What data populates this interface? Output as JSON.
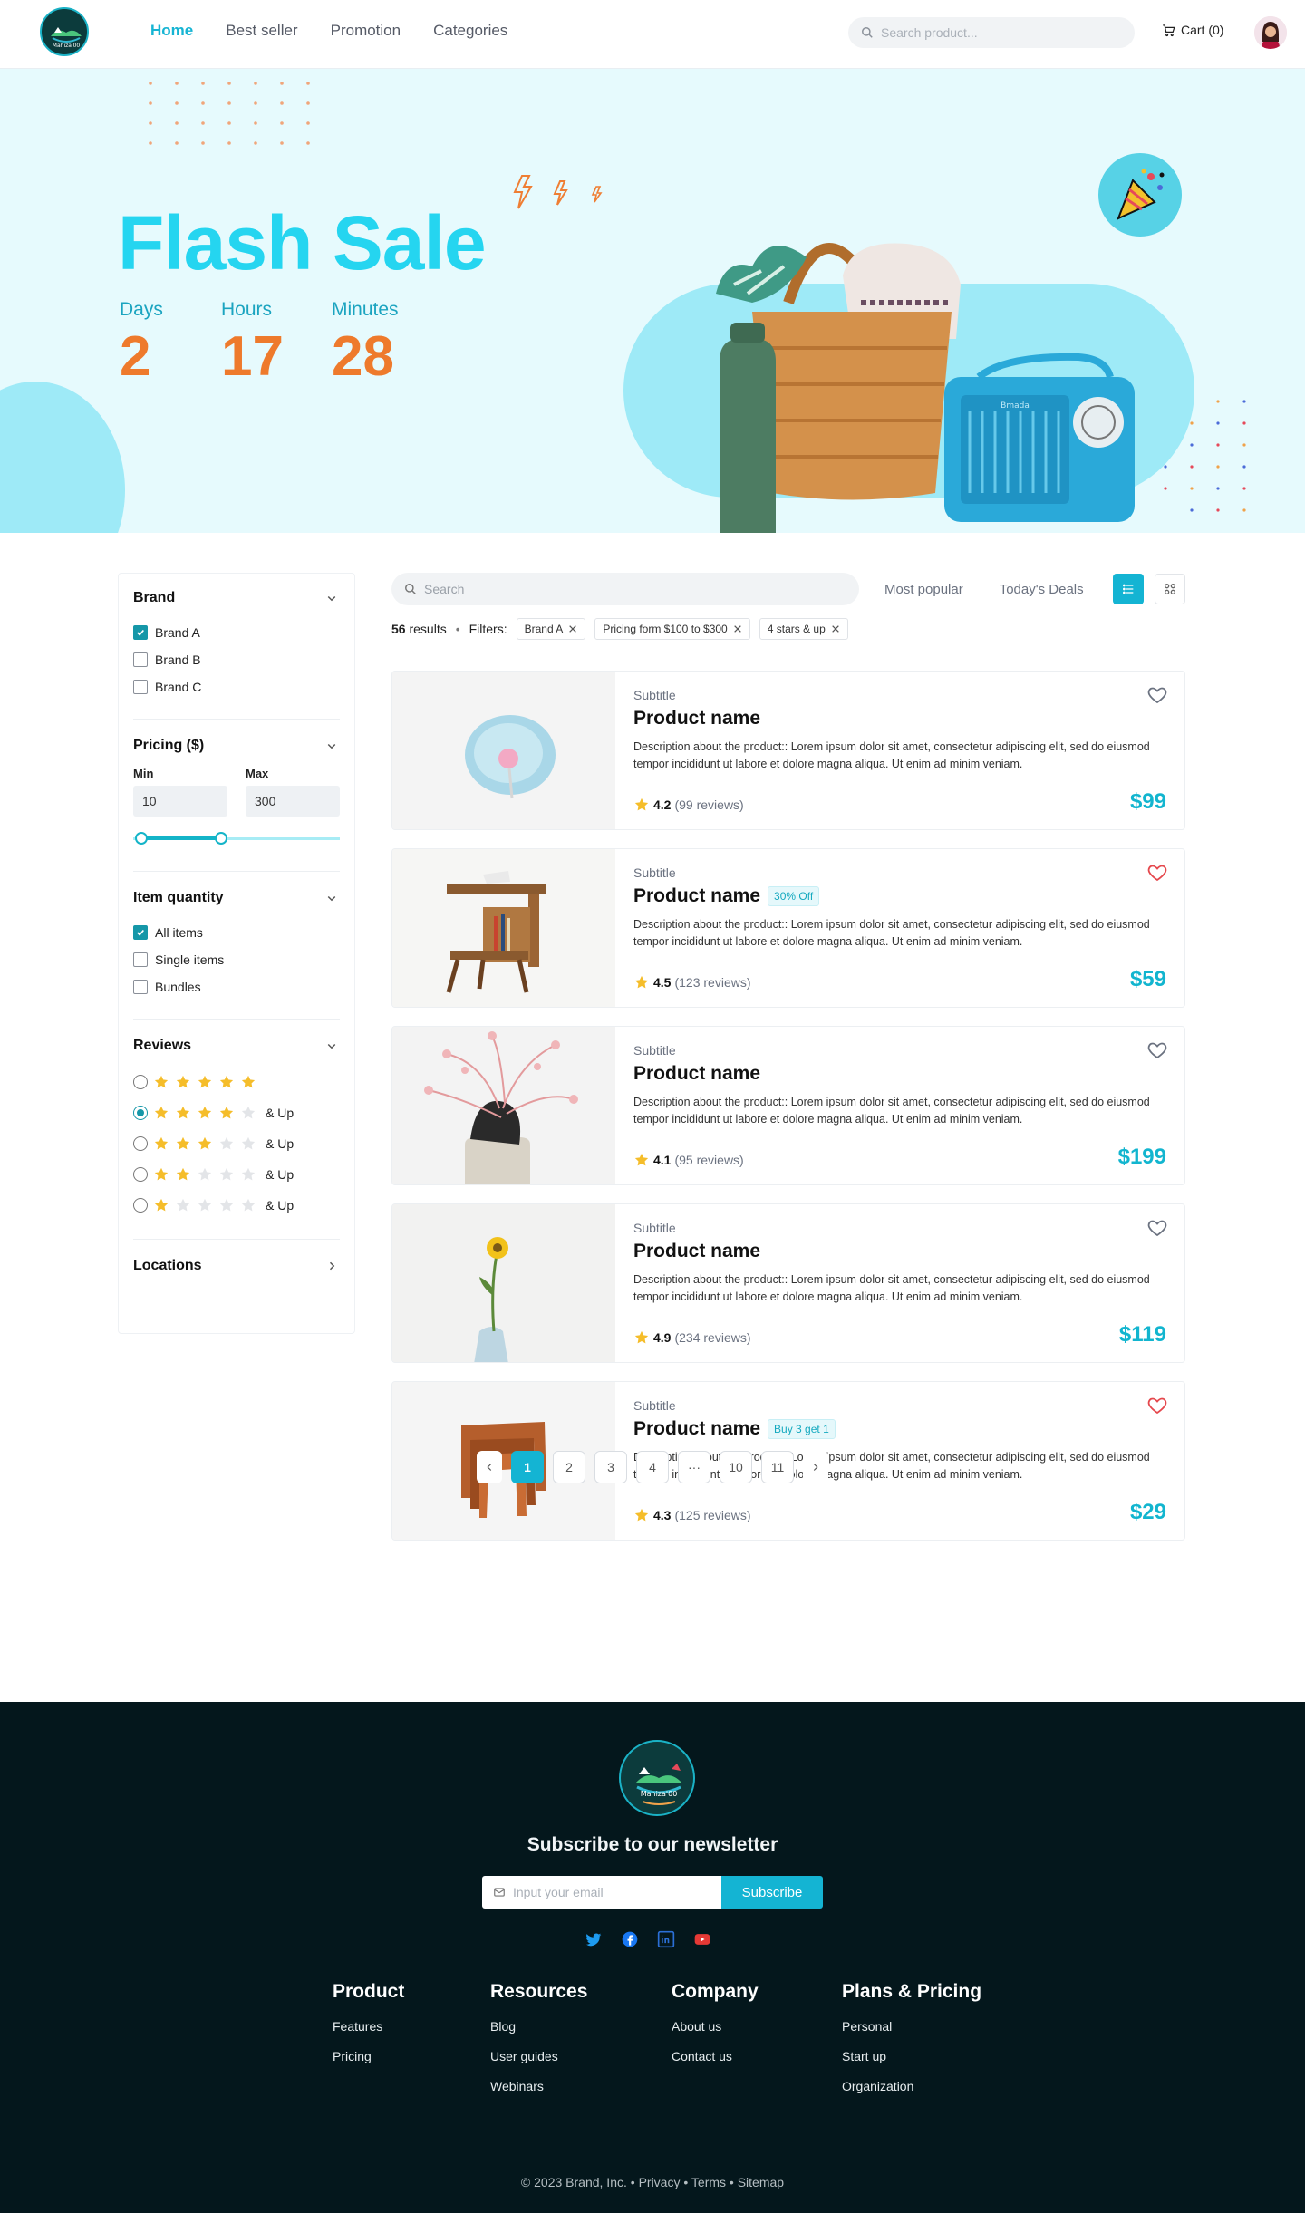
{
  "header": {
    "logo_text": "Mahiza'00",
    "nav": [
      "Home",
      "Best seller",
      "Promotion",
      "Categories"
    ],
    "search_placeholder": "Search product...",
    "cart_label": "Cart (0)"
  },
  "hero": {
    "title": "Flash Sale",
    "countdown": [
      {
        "label": "Days",
        "value": "2"
      },
      {
        "label": "Hours",
        "value": "17"
      },
      {
        "label": "Minutes",
        "value": "28"
      }
    ],
    "radio_brand_text": "Bmada"
  },
  "filters": {
    "brand": {
      "title": "Brand",
      "items": [
        {
          "label": "Brand A",
          "checked": true
        },
        {
          "label": "Brand B",
          "checked": false
        },
        {
          "label": "Brand C",
          "checked": false
        }
      ]
    },
    "pricing": {
      "title": "Pricing ($)",
      "min_label": "Min",
      "max_label": "Max",
      "min_value": "10",
      "max_value": "300"
    },
    "quantity": {
      "title": "Item quantity",
      "items": [
        {
          "label": "All items",
          "checked": true
        },
        {
          "label": "Single items",
          "checked": false
        },
        {
          "label": "Bundles",
          "checked": false
        }
      ]
    },
    "reviews": {
      "title": "Reviews",
      "and_up": "& Up",
      "selected": 4,
      "options": [
        5,
        4,
        3,
        2,
        1
      ]
    },
    "locations": {
      "title": "Locations"
    }
  },
  "toolbar": {
    "search_placeholder": "Search",
    "tabs": [
      "Most popular",
      "Today's Deals"
    ],
    "results_count": "56",
    "results_label": "results",
    "filters_label": "Filters:",
    "active_filters": [
      "Brand A",
      "Pricing form $100 to $300",
      "4 stars & up"
    ]
  },
  "products": [
    {
      "subtitle": "Subtitle",
      "name": "Product name",
      "badge": "",
      "desc": "Description about the product:: Lorem ipsum dolor sit amet, consectetur adipiscing elit, sed do eiusmod tempor incididunt ut labore et dolore magna aliqua. Ut enim ad minim veniam.",
      "rating": "4.2",
      "reviews": "(99 reviews)",
      "price": "$99",
      "liked": false
    },
    {
      "subtitle": "Subtitle",
      "name": "Product name",
      "badge": "30% Off",
      "desc": "Description about the product:: Lorem ipsum dolor sit amet, consectetur adipiscing elit, sed do eiusmod tempor incididunt ut labore et dolore magna aliqua. Ut enim ad minim veniam.",
      "rating": "4.5",
      "reviews": "(123 reviews)",
      "price": "$59",
      "liked": true
    },
    {
      "subtitle": "Subtitle",
      "name": "Product name",
      "badge": "",
      "desc": "Description about the product:: Lorem ipsum dolor sit amet, consectetur adipiscing elit, sed do eiusmod tempor incididunt ut labore et dolore magna aliqua. Ut enim ad minim veniam.",
      "rating": "4.1",
      "reviews": "(95 reviews)",
      "price": "$199",
      "liked": false
    },
    {
      "subtitle": "Subtitle",
      "name": "Product name",
      "badge": "",
      "desc": "Description about the product:: Lorem ipsum dolor sit amet, consectetur adipiscing elit, sed do eiusmod tempor incididunt ut labore et dolore magna aliqua. Ut enim ad minim veniam.",
      "rating": "4.9",
      "reviews": "(234 reviews)",
      "price": "$119",
      "liked": false
    },
    {
      "subtitle": "Subtitle",
      "name": "Product name",
      "badge": "Buy 3 get 1",
      "desc": "Description about the product:: Lorem ipsum dolor sit amet, consectetur adipiscing elit, sed do eiusmod tempor incididunt ut labore et dolore magna aliqua. Ut enim ad minim veniam.",
      "rating": "4.3",
      "reviews": "(125 reviews)",
      "price": "$29",
      "liked": true
    }
  ],
  "pagination": {
    "pages": [
      "1",
      "2",
      "3",
      "4",
      "···",
      "10",
      "11"
    ],
    "current": "1"
  },
  "footer": {
    "logo_text": "Mahiza'00",
    "newsletter_title": "Subscribe to our newsletter",
    "email_placeholder": "Input your email",
    "subscribe_label": "Subscribe",
    "social_icons": [
      "twitter-icon",
      "facebook-icon",
      "linkedin-icon",
      "youtube-icon"
    ],
    "columns": [
      {
        "title": "Product",
        "links": [
          "Features",
          "Pricing"
        ]
      },
      {
        "title": "Resources",
        "links": [
          "Blog",
          "User guides",
          "Webinars"
        ]
      },
      {
        "title": "Company",
        "links": [
          "About us",
          "Contact us"
        ]
      },
      {
        "title": "Plans & Pricing",
        "links": [
          "Personal",
          "Start up",
          "Organization"
        ]
      }
    ],
    "copyright": "© 2023 Brand, Inc.",
    "legal_links": [
      "Privacy",
      "Terms",
      "Sitemap"
    ]
  },
  "colors": {
    "accent": "#14b4d3",
    "hero_title": "#25d5f0",
    "countdown": "#ee7a2c",
    "footer_bg": "#04171c",
    "star": "#f5bd2a",
    "heart_liked": "#e5484d"
  }
}
